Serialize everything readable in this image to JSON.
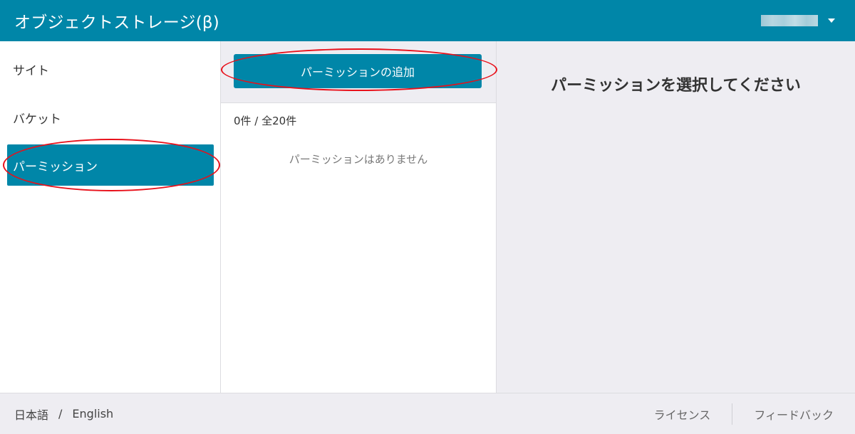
{
  "colors": {
    "brand": "#0086a8",
    "annotation": "#e8101a"
  },
  "header": {
    "title": "オブジェクトストレージ(β)",
    "user_menu_icon": "caret-down-icon"
  },
  "sidebar": {
    "items": [
      {
        "label": "サイト"
      },
      {
        "label": "バケット"
      },
      {
        "label": "パーミッション",
        "active": true
      }
    ]
  },
  "middle": {
    "add_button_label": "パーミッションの追加",
    "count_text": "0件 / 全20件",
    "empty_text": "パーミッションはありません"
  },
  "detail": {
    "prompt": "パーミッションを選択してください"
  },
  "footer": {
    "lang_ja": "日本語",
    "lang_separator": "/",
    "lang_en": "English",
    "license": "ライセンス",
    "feedback": "フィードバック"
  }
}
